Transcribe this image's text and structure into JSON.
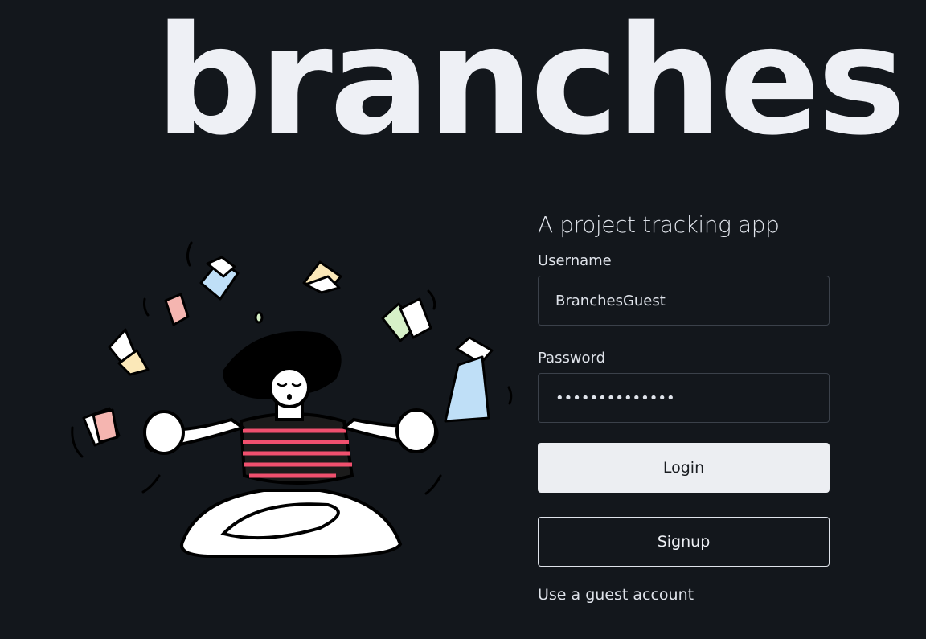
{
  "brand": {
    "logo_text": "branches"
  },
  "auth": {
    "tagline": "A project tracking app",
    "username_label": "Username",
    "username_value": "BranchesGuest",
    "password_label": "Password",
    "password_value": "••••••••••••••",
    "login_label": "Login",
    "signup_label": "Signup",
    "guest_link": "Use a guest account"
  },
  "colors": {
    "background": "#13171c",
    "text": "#dfe3ea",
    "shirt_stripe": "#f0506e",
    "paper_blue": "#bfdff7",
    "paper_pink": "#f5b5b0",
    "paper_yellow": "#fbe8b8",
    "paper_green": "#d6f0c8"
  }
}
